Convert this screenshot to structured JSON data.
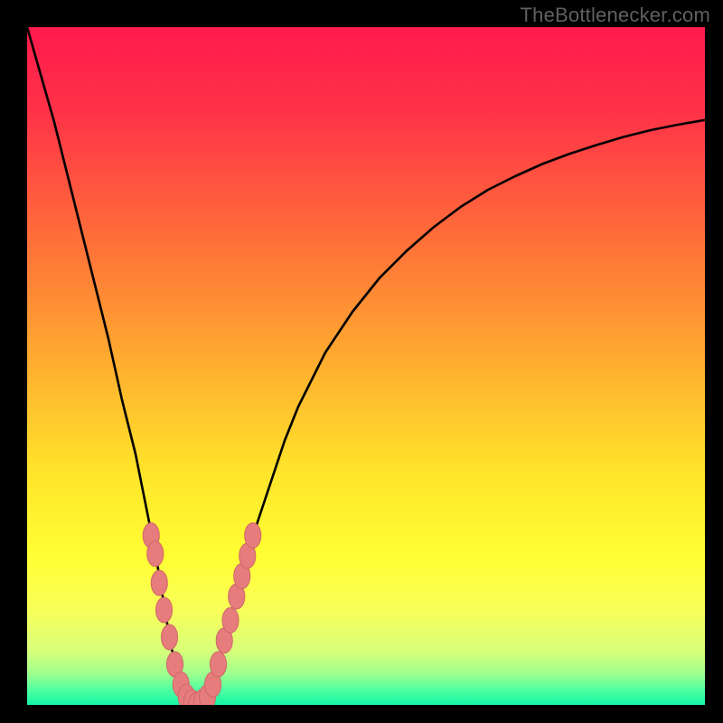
{
  "watermark": "TheBottlenecker.com",
  "colors": {
    "frame": "#000000",
    "curve": "#000000",
    "marker_fill": "#e77c7c",
    "marker_stroke": "#d16a6a",
    "gradient_stops": [
      {
        "offset": 0.0,
        "color": "#ff1a4d"
      },
      {
        "offset": 0.12,
        "color": "#ff3148"
      },
      {
        "offset": 0.3,
        "color": "#ff6a3a"
      },
      {
        "offset": 0.48,
        "color": "#ffa830"
      },
      {
        "offset": 0.65,
        "color": "#ffe22a"
      },
      {
        "offset": 0.78,
        "color": "#ffff33"
      },
      {
        "offset": 0.86,
        "color": "#f9ff59"
      },
      {
        "offset": 0.92,
        "color": "#d8ff7a"
      },
      {
        "offset": 0.955,
        "color": "#9cff8e"
      },
      {
        "offset": 0.978,
        "color": "#4effa0"
      },
      {
        "offset": 1.0,
        "color": "#14f5a6"
      }
    ]
  },
  "chart_data": {
    "type": "line",
    "title": "",
    "xlabel": "",
    "ylabel": "",
    "xlim": [
      0,
      100
    ],
    "ylim": [
      0,
      100
    ],
    "series": [
      {
        "name": "bottleneck-curve",
        "x": [
          0,
          2,
          4,
          6,
          8,
          10,
          12,
          14,
          16,
          17,
          18,
          19,
          20,
          21,
          22,
          23,
          24,
          25,
          26,
          27,
          28,
          30,
          32,
          34,
          36,
          38,
          40,
          44,
          48,
          52,
          56,
          60,
          64,
          68,
          72,
          76,
          80,
          84,
          88,
          92,
          96,
          100
        ],
        "y": [
          100,
          93,
          86,
          78,
          70,
          62,
          54,
          45,
          37,
          32,
          27,
          22,
          16,
          10,
          5,
          2,
          0.5,
          0,
          0.5,
          2,
          5,
          12,
          20,
          27,
          33,
          39,
          44,
          52,
          58,
          63,
          67,
          70.5,
          73.5,
          76,
          78,
          79.8,
          81.3,
          82.6,
          83.8,
          84.8,
          85.6,
          86.3
        ]
      }
    ],
    "markers": {
      "name": "highlight-band",
      "points": [
        {
          "x": 18.3,
          "y": 25.0,
          "r": 1.2
        },
        {
          "x": 18.9,
          "y": 22.3,
          "r": 1.2
        },
        {
          "x": 19.5,
          "y": 18.0,
          "r": 1.2
        },
        {
          "x": 20.2,
          "y": 14.0,
          "r": 1.2
        },
        {
          "x": 21.0,
          "y": 10.0,
          "r": 1.2
        },
        {
          "x": 21.8,
          "y": 6.0,
          "r": 1.2
        },
        {
          "x": 22.7,
          "y": 3.0,
          "r": 1.2
        },
        {
          "x": 23.5,
          "y": 1.2,
          "r": 1.2
        },
        {
          "x": 24.3,
          "y": 0.4,
          "r": 1.2
        },
        {
          "x": 25.0,
          "y": 0.0,
          "r": 1.2
        },
        {
          "x": 25.8,
          "y": 0.4,
          "r": 1.2
        },
        {
          "x": 26.6,
          "y": 1.2,
          "r": 1.2
        },
        {
          "x": 27.4,
          "y": 3.0,
          "r": 1.2
        },
        {
          "x": 28.2,
          "y": 6.0,
          "r": 1.2
        },
        {
          "x": 29.1,
          "y": 9.5,
          "r": 1.2
        },
        {
          "x": 30.0,
          "y": 12.5,
          "r": 1.2
        },
        {
          "x": 30.9,
          "y": 16.0,
          "r": 1.2
        },
        {
          "x": 31.7,
          "y": 19.0,
          "r": 1.2
        },
        {
          "x": 32.5,
          "y": 22.0,
          "r": 1.2
        },
        {
          "x": 33.3,
          "y": 25.0,
          "r": 1.2
        }
      ]
    }
  }
}
